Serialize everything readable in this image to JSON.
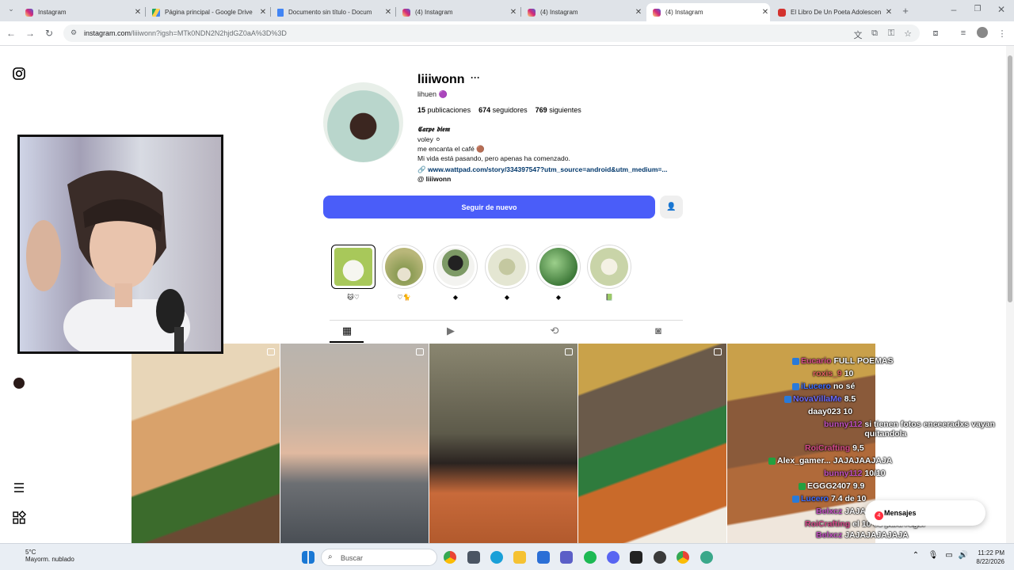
{
  "browser": {
    "tabs": [
      {
        "title": "Instagram",
        "active": false
      },
      {
        "title": "Página principal - Google Drive",
        "active": false
      },
      {
        "title": "Documento sin título - Docum",
        "active": false
      },
      {
        "title": "(4) Instagram",
        "active": false
      },
      {
        "title": "(4) Instagram",
        "active": false
      },
      {
        "title": "(4) Instagram",
        "active": true
      },
      {
        "title": "El Libro De Un Poeta Adolescen",
        "active": false
      }
    ],
    "url_host": "instagram.com",
    "url_path": "/liiiwonn?igsh=MTk0NDN2N2hjdGZ0aA%3D%3D"
  },
  "profile": {
    "username": "liiiwonn",
    "more": "···",
    "full_name": "lihuen 🟣",
    "stats": {
      "posts_count": "15",
      "posts_label": "publicaciones",
      "followers_count": "674",
      "followers_label": "seguidores",
      "following_count": "769",
      "following_label": "siguientes"
    },
    "bio": {
      "title": "𝕮𝖆𝖗𝖕𝖊 𝖉𝖎𝖊𝖒",
      "line1": "voley ⚪",
      "line2": "me encanta el café 🟤",
      "line3": "Mi vida está pasando, pero apenas ha comenzado.",
      "link": "www.wattpad.com/story/334397547?utm_source=android&utm_medium=...",
      "threads": "liiiwonn"
    },
    "follow_button": "Seguir de nuevo"
  },
  "highlights": [
    {
      "label": "🐱♡"
    },
    {
      "label": "♡🐈"
    },
    {
      "label": "◆"
    },
    {
      "label": "◆"
    },
    {
      "label": "◆"
    },
    {
      "label": "📗"
    }
  ],
  "chat": [
    {
      "user": "Eucario",
      "msg": "FULL POEMAS",
      "color": "#d44a8a"
    },
    {
      "user": "roxis_9",
      "msg": "10",
      "color": "#e05e5e"
    },
    {
      "user": "iLucero",
      "msg": "no sé",
      "color": "#3b6cff"
    },
    {
      "user": "NovaVillaMe",
      "msg": "8.5",
      "color": "#6b6bff"
    },
    {
      "user": "daay023",
      "msg": "10",
      "color": "#1a1a1a"
    },
    {
      "user": "bunny112",
      "msg": "si tienen fotos enceeradxs vayan quitandola",
      "color": "#c04fc0"
    },
    {
      "user": "RoiCrafting",
      "msg": "9,5",
      "color": "#d44a8a"
    },
    {
      "user": "Alex_gamer...",
      "msg": "JAJAJAAJAJA",
      "color": "#1a1a1a"
    },
    {
      "user": "bunny112",
      "msg": "10/10",
      "color": "#c04fc0"
    },
    {
      "user": "EGGG2407",
      "msg": "9.9",
      "color": "#22a040"
    },
    {
      "user": "Lucero",
      "msg": "7.4 de 10",
      "color": "#3b6cff"
    },
    {
      "user": "Belxcz",
      "msg": "JAJAJA JAJAJAJAJ",
      "color": "#c04fc0"
    },
    {
      "user": "RoiCrafting",
      "msg": "el 10 es para roger",
      "color": "#d44a8a"
    },
    {
      "user": "Belxcz",
      "msg": "JAJAJAJAJAJA",
      "color": "#c04fc0"
    }
  ],
  "messages_pill": {
    "label": "Mensajes",
    "badge": "4"
  },
  "taskbar": {
    "weather_temp": "5°C",
    "weather_desc": "Mayorm. nublado",
    "search_placeholder": "Buscar",
    "time": "11:22 PM",
    "date": "8/22/2026"
  },
  "colors": {
    "accent": "#4a5df9",
    "link": "#00376b"
  }
}
